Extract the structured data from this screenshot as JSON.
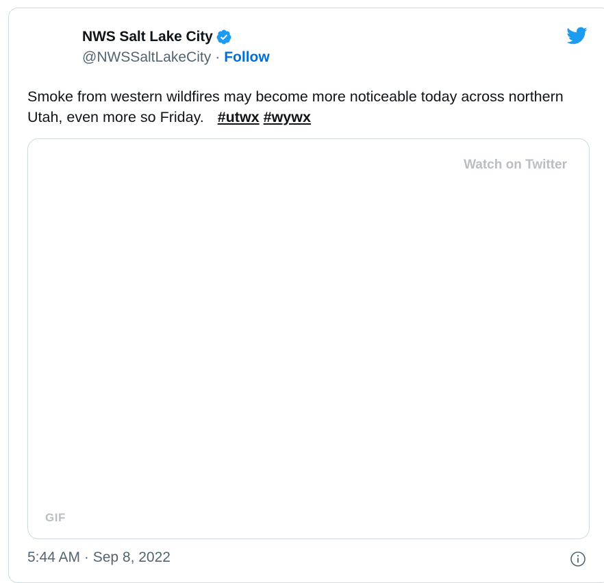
{
  "tweet": {
    "display_name": "NWS Salt Lake City",
    "handle": "@NWSSaltLakeCity",
    "separator": "·",
    "follow_label": "Follow",
    "text": "Smoke from western wildfires may become more noticeable today across northern Utah, even more so Friday.",
    "hashtags": [
      "#utwx",
      "#wywx"
    ],
    "media": {
      "watch_label": "Watch on Twitter",
      "badge": "GIF"
    },
    "timestamp": "5:44 AM · Sep 8, 2022"
  },
  "icons": {
    "verified": "verified-badge-icon",
    "brand": "twitter-bird-icon",
    "info": "info-icon"
  },
  "colors": {
    "brand_blue": "#1d9bf0",
    "follow_blue": "#006fd6",
    "text_primary": "#0f1419",
    "text_secondary": "#536471",
    "border": "#cfd9de",
    "muted_label": "#b8bec3"
  }
}
